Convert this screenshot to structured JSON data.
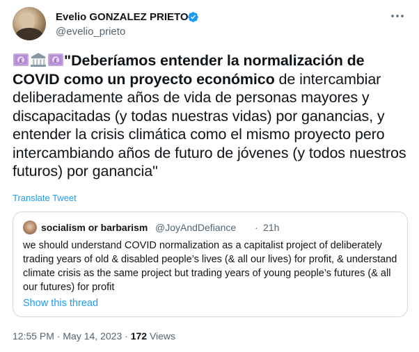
{
  "author": {
    "name": "Evelio GONZALEZ PRIETO",
    "handle": "@evelio_prieto",
    "verified": true
  },
  "icons": {
    "verified": "verified-badge-icon",
    "more": "more-options-icon",
    "money": "money-bag-emoji",
    "bank": "bank-emoji"
  },
  "tweet": {
    "bold_text": "\"Deberíamos entender la normalización de COVID como un proyecto económico",
    "regular_text": " de intercambiar deliberadamente años de vida de personas mayores y discapacitadas (y todas nuestras vidas) por ganancias, y entender la crisis climática como el mismo proyecto pero intercambiando años de futuro de jóvenes (y todos nuestros futuros) por ganancia\"",
    "translate_label": "Translate Tweet"
  },
  "quote": {
    "name": "socialism or barbarism",
    "handle": "@JoyAndDefiance",
    "separator": "·",
    "time": "21h",
    "text": "we should understand COVID normalization as a capitalist project of deliberately trading years of old & disabled people’s lives (& all our lives) for profit, & understand climate crisis as the same project but trading years of young people’s futures (& all our futures) for profit",
    "show_thread": "Show this thread"
  },
  "meta": {
    "time": "12:55 PM",
    "separator": " · ",
    "date": "May 14, 2023",
    "views_count": "172",
    "views_label": "Views"
  },
  "colors": {
    "text": "#0f1419",
    "secondary": "#536471",
    "link": "#1d9bf0",
    "border": "#cfd9de",
    "verified": "#1d9bf0"
  }
}
